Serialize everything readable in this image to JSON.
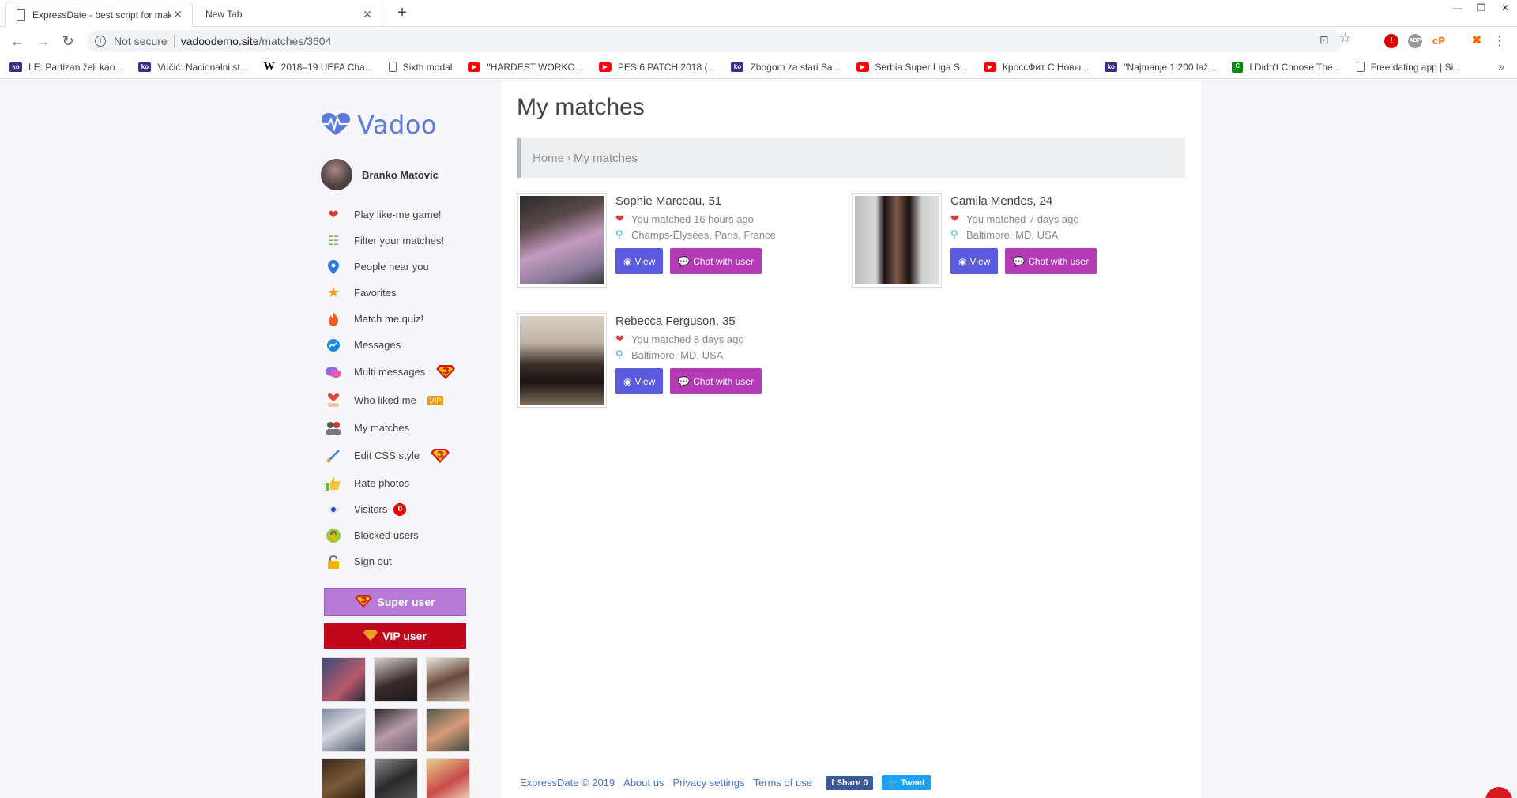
{
  "browser": {
    "tabs": [
      {
        "title": "ExpressDate - best script for mak",
        "active": true
      },
      {
        "title": "New Tab",
        "active": false
      }
    ],
    "new_tab": "+",
    "security": "Not secure",
    "url_domain": "vadoodemo.site",
    "url_path": "/matches/3604",
    "bookmarks": [
      {
        "label": "LE: Partizan želi kao...",
        "icon": "k-icon"
      },
      {
        "label": "Vučić: Nacionalni st...",
        "icon": "k-icon"
      },
      {
        "label": "2018–19 UEFA Cha...",
        "icon": "wikipedia-icon"
      },
      {
        "label": "Sixth modal",
        "icon": "page-icon"
      },
      {
        "label": "\"HARDEST WORKO...",
        "icon": "youtube-icon"
      },
      {
        "label": "PES 6 PATCH 2018 (...",
        "icon": "youtube-icon"
      },
      {
        "label": "Zbogom za stari Sa...",
        "icon": "k-icon"
      },
      {
        "label": "Serbia Super Liga S...",
        "icon": "youtube-icon"
      },
      {
        "label": "КроссФит С Новы...",
        "icon": "youtube-icon"
      },
      {
        "label": "\"Najmanje 1.200 laž...",
        "icon": "k-icon"
      },
      {
        "label": "I Didn't Choose The...",
        "icon": "c-icon"
      },
      {
        "label": "Free dating app | Si...",
        "icon": "page-icon"
      }
    ],
    "bookmarks_more": "»"
  },
  "sidebar": {
    "logo": "Vadoo",
    "user_name": "Branko Matovic",
    "menu": [
      {
        "label": "Play like-me game!",
        "icon": "heart-icon"
      },
      {
        "label": "Filter your matches!",
        "icon": "filter-icon"
      },
      {
        "label": "People near you",
        "icon": "location-pin-icon"
      },
      {
        "label": "Favorites",
        "icon": "star-icon"
      },
      {
        "label": "Match me quiz!",
        "icon": "fire-icon"
      },
      {
        "label": "Messages",
        "icon": "messenger-icon"
      },
      {
        "label": "Multi messages",
        "icon": "chat-bubbles-icon",
        "extra": "superman"
      },
      {
        "label": "Who liked me",
        "icon": "hand-heart-icon",
        "extra": "vip"
      },
      {
        "label": "My matches",
        "icon": "couple-icon"
      },
      {
        "label": "Edit CSS style",
        "icon": "brush-icon",
        "extra": "superman"
      },
      {
        "label": "Rate photos",
        "icon": "thumbs-up-icon"
      },
      {
        "label": "Visitors",
        "icon": "eye-icon",
        "badge": "0"
      },
      {
        "label": "Blocked users",
        "icon": "lock-green-icon"
      },
      {
        "label": "Sign out",
        "icon": "padlock-icon"
      }
    ],
    "vip_badge_text": "VIP",
    "super_user_label": "Super user",
    "vip_user_label": "VIP user"
  },
  "main": {
    "title": "My matches",
    "breadcrumb": {
      "home": "Home",
      "separator": "›",
      "current": "My matches"
    },
    "matches": [
      {
        "name": "Sophie Marceau, 51",
        "matched": "You matched 16 hours ago",
        "location": "Champs-Élysées, Paris, France",
        "view": "View",
        "chat": "Chat with user"
      },
      {
        "name": "Camila Mendes, 24",
        "matched": "You matched 7 days ago",
        "location": "Baltimore, MD, USA",
        "view": "View",
        "chat": "Chat with user"
      },
      {
        "name": "Rebecca Ferguson, 35",
        "matched": "You matched 8 days ago",
        "location": "Baltimore, MD, USA",
        "view": "View",
        "chat": "Chat with user"
      }
    ]
  },
  "footer": {
    "copyright": "ExpressDate © 2019",
    "about": "About us",
    "privacy": "Privacy settings",
    "terms": "Terms of use",
    "share": "Share 0",
    "tweet": "Tweet"
  },
  "colors": {
    "accent_logo": "#5a7be0",
    "view_button": "#5a5ae0",
    "chat_button": "#b43bb4",
    "super_user": "#b57bd6",
    "vip_user": "#c0071c"
  }
}
